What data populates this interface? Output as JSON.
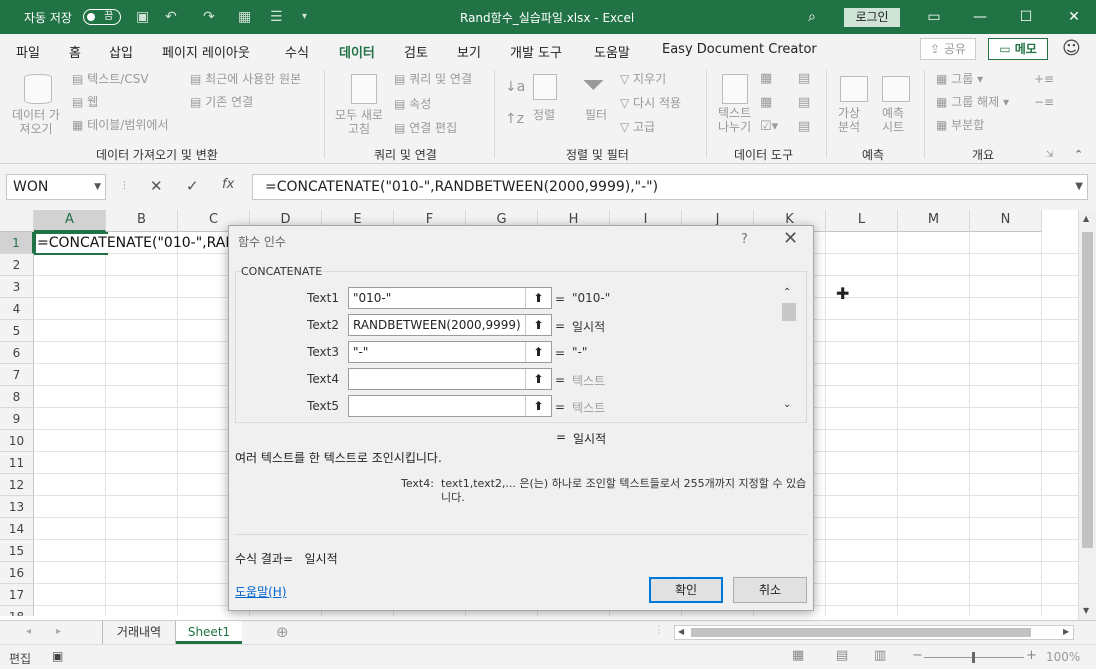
{
  "titlebar": {
    "autosave_label": "자동 저장",
    "toggle_state": "끔",
    "title": "Rand함수_실습파일.xlsx  -  Excel",
    "login": "로그인"
  },
  "tabs": [
    "파일",
    "홈",
    "삽입",
    "페이지 레이아웃",
    "수식",
    "데이터",
    "검토",
    "보기",
    "개발 도구",
    "도움말",
    "Easy Document Creator"
  ],
  "share": "공유",
  "memo": "메모",
  "ribbon": {
    "get_data": "데이터 가\n져오기",
    "from_text": "텍스트/CSV",
    "from_web": "웹",
    "from_table": "테이블/범위에서",
    "recent_sources": "최근에 사용한 원본",
    "existing_conn": "기존 연결",
    "refresh_all": "모두 새로\n고침",
    "queries": "쿼리 및 연결",
    "properties": "속성",
    "edit_links": "연결 편집",
    "sort": "정렬",
    "filter": "필터",
    "clear": "지우기",
    "reapply": "다시 적용",
    "advanced": "고급",
    "text_to_cols": "텍스트\n나누기",
    "what_if": "가상\n분석",
    "forecast_sheet": "예측\n시트",
    "group": "그룹",
    "ungroup": "그룹 해제",
    "subtotal": "부분합",
    "groups": [
      "데이터 가져오기 및 변환",
      "쿼리 및 연결",
      "정렬 및 필터",
      "데이터 도구",
      "예측",
      "개요"
    ]
  },
  "formula_bar": {
    "name_box": "WON",
    "formula": "=CONCATENATE(\"010-\",RANDBETWEEN(2000,9999),\"-\")"
  },
  "columns": [
    "A",
    "B",
    "C",
    "D",
    "E",
    "F",
    "G",
    "H",
    "I",
    "J",
    "K",
    "L",
    "M",
    "N"
  ],
  "rows": [
    "1",
    "2",
    "3",
    "4",
    "5",
    "6",
    "7",
    "8",
    "9",
    "10",
    "11",
    "12",
    "13",
    "14",
    "15",
    "16",
    "17",
    "18"
  ],
  "cell_a1": "=CONCATENATE(\"010-\",RAN",
  "sheets": [
    "거래내역",
    "Sheet1"
  ],
  "status": {
    "mode": "편집",
    "zoom": "100%"
  },
  "dialog": {
    "title": "함수 인수",
    "function": "CONCATENATE",
    "args": [
      {
        "label": "Text1",
        "value": "\"010-\"",
        "result": "\"010-\"",
        "dim": false
      },
      {
        "label": "Text2",
        "value": "RANDBETWEEN(2000,9999)",
        "result": "일시적",
        "dim": false
      },
      {
        "label": "Text3",
        "value": "\"-\"",
        "result": "\"-\"",
        "dim": false
      },
      {
        "label": "Text4",
        "value": "",
        "result": "텍스트",
        "dim": true
      },
      {
        "label": "Text5",
        "value": "",
        "result": "텍스트",
        "dim": true
      }
    ],
    "result_top": "일시적",
    "description": "여러 텍스트를 한 텍스트로 조인시킵니다.",
    "arg_name": "Text4:",
    "arg_description": "text1,text2,... 은(는) 하나로 조인할 텍스트들로서 255개까지 지정할 수 있습니다.",
    "formula_result_label": "수식 결과=",
    "formula_result": "일시적",
    "help": "도움말(H)",
    "ok": "확인",
    "cancel": "취소"
  }
}
